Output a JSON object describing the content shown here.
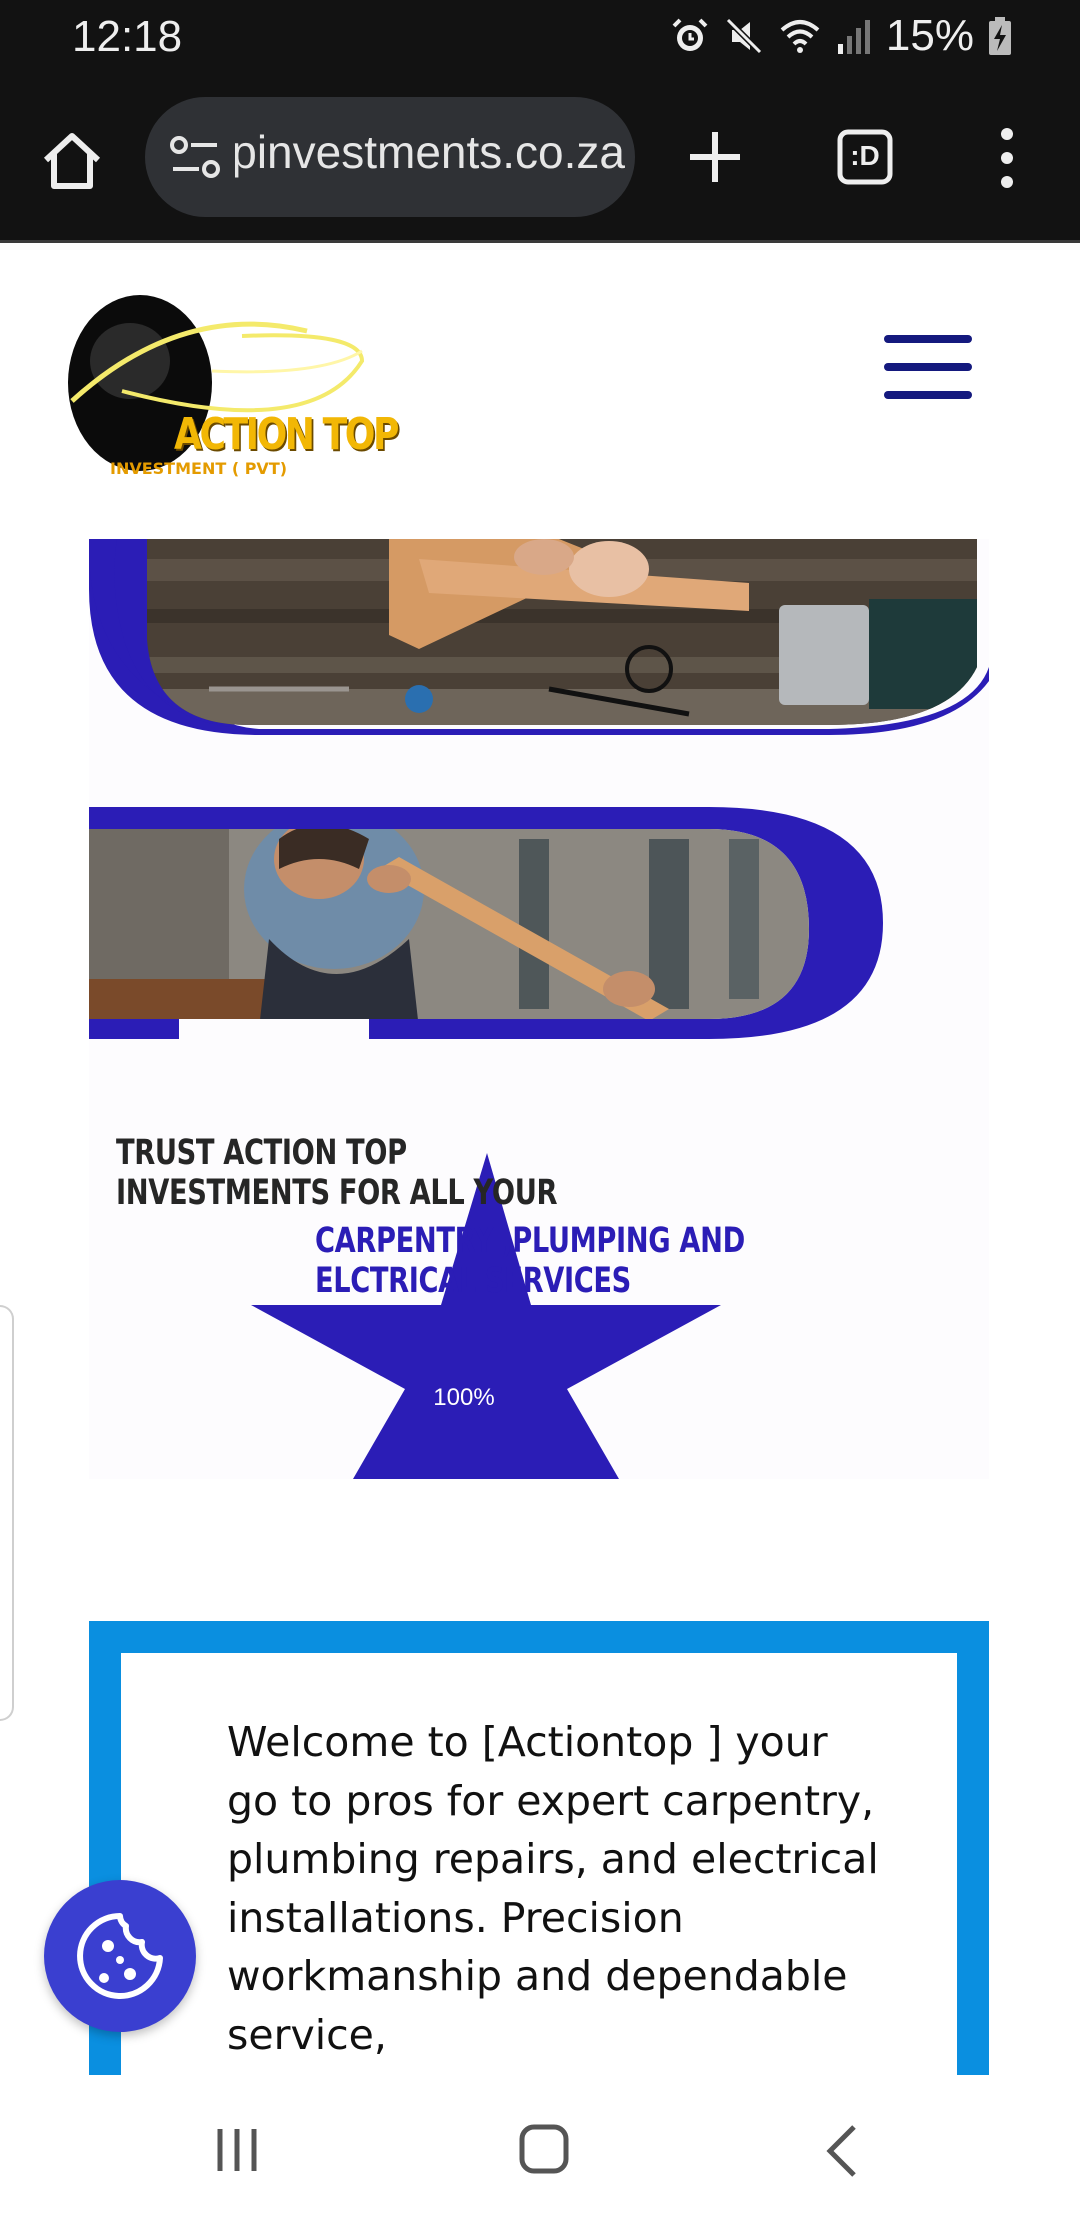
{
  "status_bar": {
    "time": "12:18",
    "battery": "15%",
    "icons": [
      "alarm-icon",
      "mute-icon",
      "wifi-icon",
      "signal-icon",
      "battery-charging-icon"
    ]
  },
  "browser": {
    "url": "actiontopinvestments.co.za",
    "buttons": [
      "home-icon",
      "site-info-icon",
      "new-tab-icon",
      "tab-switcher-icon",
      "more-menu-icon"
    ],
    "tab_switcher_label": ":D"
  },
  "site": {
    "logo": {
      "title": "ACTION TOP",
      "subtitle": "INVESTMENT ( PVT)"
    },
    "hero": {
      "line_1": "TRUST ACTION TOP INVESTMENTS FOR ALL YOUR",
      "line_2": "CARPENTRY ,PLUMPING AND ELCTRICAL SERVICES",
      "badge": "100%"
    },
    "welcome": {
      "text": "Welcome to [Actiontop ] your go to pros for expert carpentry, plumbing repairs, and electrical installations. Precision workmanship and dependable service,"
    }
  },
  "colors": {
    "brand_blue": "#2b1db6",
    "welcome_border": "#0a8fe0",
    "cookie_button": "#3a3fd0",
    "logo_gold": "#f2b705"
  },
  "nav_bar": {
    "buttons": [
      "recent-apps-icon",
      "home-nav-icon",
      "back-icon"
    ]
  }
}
